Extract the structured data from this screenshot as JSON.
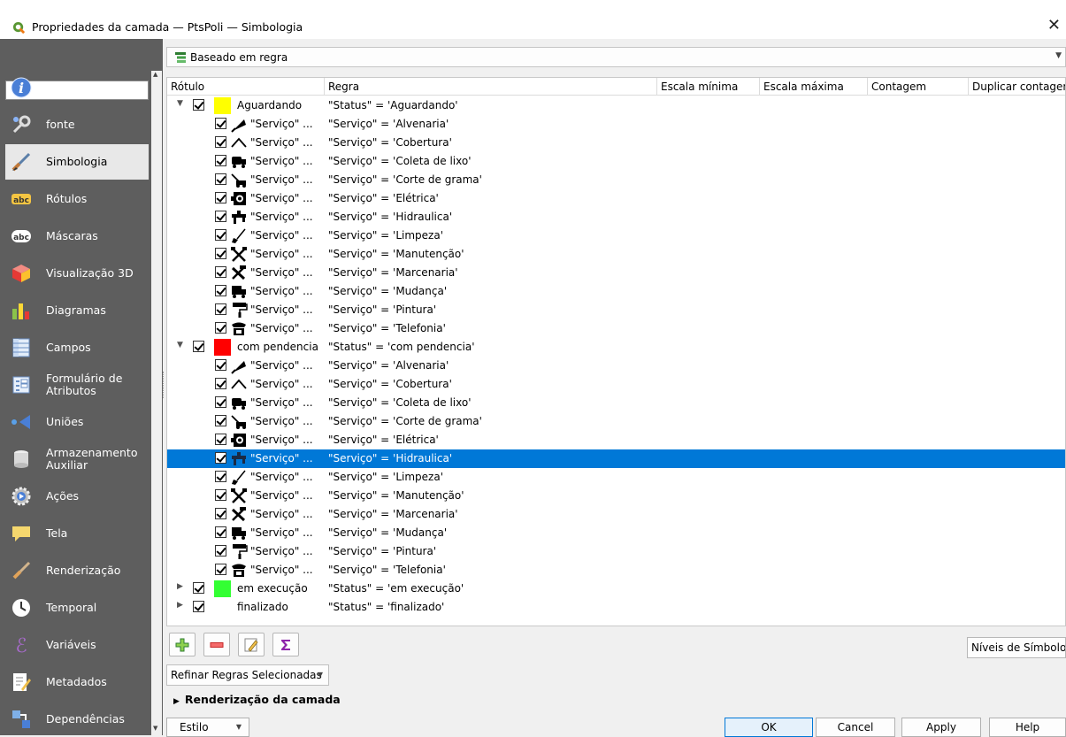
{
  "window": {
    "title": "Propriedades da camada — PtsPoli — Simbologia"
  },
  "sidebar": {
    "search_placeholder": "",
    "items": [
      {
        "label": "Informação",
        "icon": "info-icon"
      },
      {
        "label": "fonte",
        "icon": "wrench-icon"
      },
      {
        "label": "Simbologia",
        "icon": "paintbrush-icon"
      },
      {
        "label": "Rótulos",
        "icon": "abc-labels-icon"
      },
      {
        "label": "Máscaras",
        "icon": "abc-mask-icon"
      },
      {
        "label": "Visualização 3D",
        "icon": "cube-3d-icon"
      },
      {
        "label": "Diagramas",
        "icon": "diagram-icon"
      },
      {
        "label": "Campos",
        "icon": "fields-table-icon"
      },
      {
        "label": "Formulário de Atributos",
        "icon": "form-icon"
      },
      {
        "label": "Uniões",
        "icon": "join-icon"
      },
      {
        "label": "Armazenamento Auxiliar",
        "icon": "database-icon"
      },
      {
        "label": "Ações",
        "icon": "gear-actions-icon"
      },
      {
        "label": "Tela",
        "icon": "speech-bubble-icon"
      },
      {
        "label": "Renderização",
        "icon": "brush-render-icon"
      },
      {
        "label": "Temporal",
        "icon": "clock-icon"
      },
      {
        "label": "Variáveis",
        "icon": "epsilon-icon"
      },
      {
        "label": "Metadados",
        "icon": "metadata-pen-icon"
      },
      {
        "label": "Dependências",
        "icon": "dependencies-icon"
      }
    ],
    "selected_index": 2
  },
  "renderer": {
    "label": "Baseado em regra"
  },
  "tree": {
    "columns": [
      "Rótulo",
      "Regra",
      "Escala mínima",
      "Escala máxima",
      "Contagem",
      "Duplicar contagem"
    ],
    "groups": [
      {
        "label": "Aguardando",
        "rule": "\"Status\" = 'Aguardando'",
        "color": "#ffff00",
        "expanded": true,
        "children": [
          {
            "label": "\"Serviço\" ...",
            "rule": "\"Serviço\" = 'Alvenaria'",
            "icon": "trowel-icon"
          },
          {
            "label": "\"Serviço\" ...",
            "rule": "\"Serviço\" = 'Cobertura'",
            "icon": "roof-icon"
          },
          {
            "label": "\"Serviço\" ...",
            "rule": "\"Serviço\" = 'Coleta de lixo'",
            "icon": "garbage-truck-icon"
          },
          {
            "label": "\"Serviço\" ...",
            "rule": "\"Serviço\" = 'Corte de grama'",
            "icon": "lawnmower-icon"
          },
          {
            "label": "\"Serviço\" ...",
            "rule": "\"Serviço\" = 'Elétrica'",
            "icon": "electric-icon"
          },
          {
            "label": "\"Serviço\" ...",
            "rule": "\"Serviço\" = 'Hidraulica'",
            "icon": "faucet-icon"
          },
          {
            "label": "\"Serviço\" ...",
            "rule": "\"Serviço\" = 'Limpeza'",
            "icon": "broom-icon"
          },
          {
            "label": "\"Serviço\" ...",
            "rule": "\"Serviço\" = 'Manutenção'",
            "icon": "tools-icon"
          },
          {
            "label": "\"Serviço\" ...",
            "rule": "\"Serviço\" = 'Marcenaria'",
            "icon": "hammer-saw-icon"
          },
          {
            "label": "\"Serviço\" ...",
            "rule": "\"Serviço\" = 'Mudança'",
            "icon": "moving-truck-icon"
          },
          {
            "label": "\"Serviço\" ...",
            "rule": "\"Serviço\" = 'Pintura'",
            "icon": "paint-roller-icon"
          },
          {
            "label": "\"Serviço\" ...",
            "rule": "\"Serviço\" = 'Telefonia'",
            "icon": "telephone-icon"
          }
        ]
      },
      {
        "label": "com pendencia",
        "rule": "\"Status\" = 'com pendencia'",
        "color": "#ff0000",
        "expanded": true,
        "children": [
          {
            "label": "\"Serviço\" ...",
            "rule": "\"Serviço\" = 'Alvenaria'",
            "icon": "trowel-icon"
          },
          {
            "label": "\"Serviço\" ...",
            "rule": "\"Serviço\" = 'Cobertura'",
            "icon": "roof-icon"
          },
          {
            "label": "\"Serviço\" ...",
            "rule": "\"Serviço\" = 'Coleta de lixo'",
            "icon": "garbage-truck-icon"
          },
          {
            "label": "\"Serviço\" ...",
            "rule": "\"Serviço\" = 'Corte de grama'",
            "icon": "lawnmower-icon"
          },
          {
            "label": "\"Serviço\" ...",
            "rule": "\"Serviço\" = 'Elétrica'",
            "icon": "electric-icon"
          },
          {
            "label": "\"Serviço\" ...",
            "rule": "\"Serviço\" = 'Hidraulica'",
            "icon": "faucet-icon",
            "selected": true
          },
          {
            "label": "\"Serviço\" ...",
            "rule": "\"Serviço\" = 'Limpeza'",
            "icon": "broom-icon"
          },
          {
            "label": "\"Serviço\" ...",
            "rule": "\"Serviço\" = 'Manutenção'",
            "icon": "tools-icon"
          },
          {
            "label": "\"Serviço\" ...",
            "rule": "\"Serviço\" = 'Marcenaria'",
            "icon": "hammer-saw-icon"
          },
          {
            "label": "\"Serviço\" ...",
            "rule": "\"Serviço\" = 'Mudança'",
            "icon": "moving-truck-icon"
          },
          {
            "label": "\"Serviço\" ...",
            "rule": "\"Serviço\" = 'Pintura'",
            "icon": "paint-roller-icon"
          },
          {
            "label": "\"Serviço\" ...",
            "rule": "\"Serviço\" = 'Telefonia'",
            "icon": "telephone-icon"
          }
        ]
      },
      {
        "label": "em execução",
        "rule": "\"Status\" = 'em execução'",
        "color": "#33ff33",
        "expanded": false,
        "children": []
      },
      {
        "label": "finalizado",
        "rule": "\"Status\" = 'finalizado'",
        "color": "",
        "expanded": false,
        "children": []
      }
    ]
  },
  "toolbar": {
    "add_icon": "plus-icon",
    "remove_icon": "minus-icon",
    "edit_icon": "edit-pencil-icon",
    "sum_icon": "sigma-icon",
    "levels_label": "Níveis de Símbolo..."
  },
  "refine": {
    "label": "Refinar Regras Selecionadas"
  },
  "section": {
    "label": "Renderização da camada"
  },
  "buttons": {
    "style": "Estilo",
    "ok": "OK",
    "cancel": "Cancel",
    "apply": "Apply",
    "help": "Help"
  },
  "colors": {
    "sidebar_bg": "#5e5e5e",
    "selection": "#0078d7"
  }
}
